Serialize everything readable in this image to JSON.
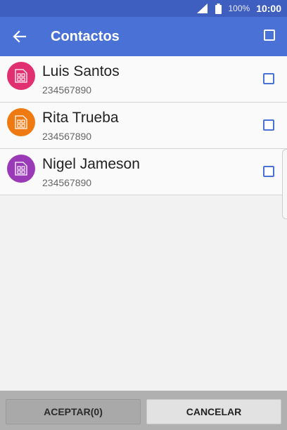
{
  "status_bar": {
    "battery_percent": "100%",
    "time": "10:00",
    "icons": [
      "signal-icon",
      "battery-icon"
    ]
  },
  "app_bar": {
    "title": "Contactos",
    "back_icon": "arrow-left-icon",
    "select_all_checked": false
  },
  "contacts": [
    {
      "name": "Luis Santos",
      "number": "234567890",
      "avatar_color": "#e0306f",
      "icon": "sim-card-icon",
      "checked": false
    },
    {
      "name": "Rita Trueba",
      "number": "234567890",
      "avatar_color": "#f07a12",
      "icon": "sim-card-icon",
      "checked": false
    },
    {
      "name": "Nigel Jameson",
      "number": "234567890",
      "avatar_color": "#9a3ab6",
      "icon": "sim-card-icon",
      "checked": false
    }
  ],
  "actions": {
    "accept_label": "ACEPTAR(0)",
    "cancel_label": "CANCELAR"
  },
  "colors": {
    "status_bar": "#3f5fc0",
    "app_bar": "#4a72d6",
    "checkbox": "#4a72d6"
  }
}
